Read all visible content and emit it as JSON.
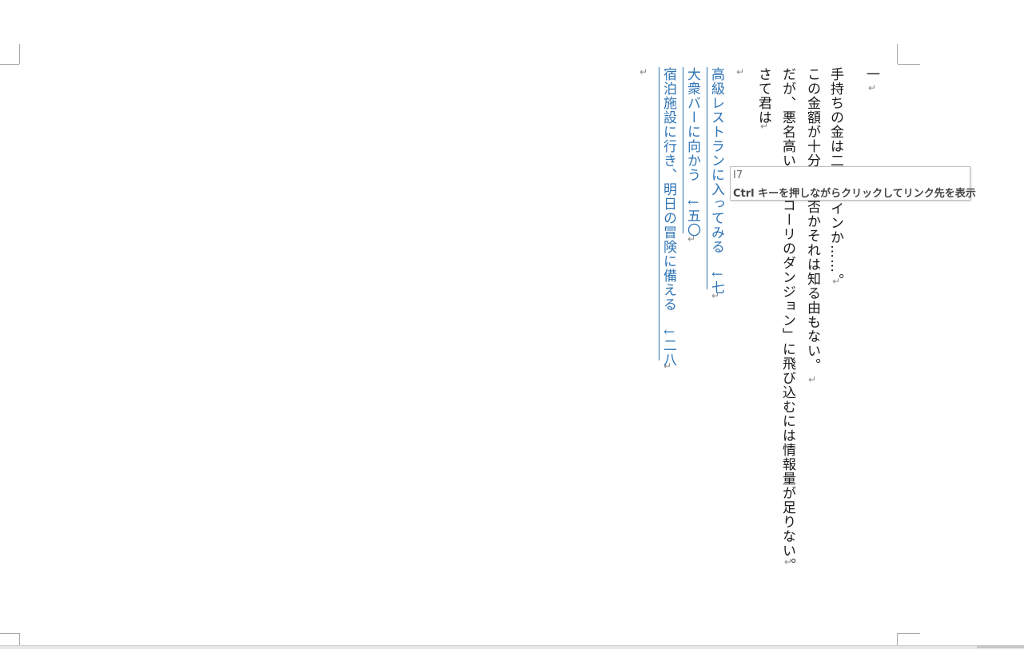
{
  "document": {
    "section_number": "一",
    "paragraph_mark": "↵",
    "lines": [
      {
        "id": "line1",
        "text": "手持ちの金は二",
        "tail": "インか……。"
      },
      {
        "id": "line2",
        "text": "この金額が十分",
        "tail": "か否かそれは知る由もない。"
      },
      {
        "id": "line3",
        "text": "だが、悪名高い",
        "tail": "コーリのダンジョン」に飛び込むには情報量が足りない。"
      },
      {
        "id": "line4",
        "text": "さて君は"
      }
    ],
    "choices": [
      {
        "label": "高級レストランに入ってみる",
        "target": "↓七"
      },
      {
        "label": "大衆バーに向かう",
        "target": "↓五〇"
      },
      {
        "label": "宿泊施設に行き、明日の冒険に備える",
        "target": "↓二八"
      }
    ]
  },
  "tooltip": {
    "number": "I7",
    "text": "Ctrl キーを押しながらクリックしてリンク先を表示"
  },
  "colors": {
    "link": "#2e74b5",
    "text": "#1a1a1a",
    "mark": "#8a8a8a"
  }
}
